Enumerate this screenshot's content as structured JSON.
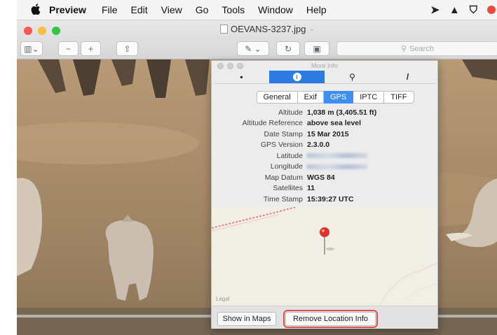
{
  "menubar": {
    "apple_glyph": "",
    "items": [
      "Preview",
      "File",
      "Edit",
      "View",
      "Go",
      "Tools",
      "Window",
      "Help"
    ],
    "status_icons": [
      "swirl-icon",
      "triangle-icon",
      "shield-icon",
      "badge-icon"
    ]
  },
  "window": {
    "title": "OEVANS-3237.jpg",
    "title_chevron": "⌄",
    "toolbar": {
      "sidebar_glyph": "▥⌄",
      "zoom_out": "−",
      "zoom_in": "+",
      "share_glyph": "⇧",
      "markup_glyph": "✎ ⌄",
      "rotate_glyph": "↻",
      "briefcase_glyph": "▣",
      "search_placeholder": "Search"
    }
  },
  "inspector": {
    "title": "More Info",
    "tabs": [
      {
        "name": "general-info-tab",
        "glyph": "▪"
      },
      {
        "name": "info-tab",
        "glyph": "i"
      },
      {
        "name": "magnify-tab",
        "glyph": "⚲"
      },
      {
        "name": "annotate-tab",
        "glyph": "/"
      }
    ],
    "segments": [
      "General",
      "Exif",
      "GPS",
      "IPTC",
      "TIFF"
    ],
    "active_segment": "GPS",
    "rows": [
      {
        "label": "Altitude",
        "value": "1,038 m (3,405.51 ft)"
      },
      {
        "label": "Altitude Reference",
        "value": "above sea level"
      },
      {
        "label": "Date Stamp",
        "value": "15 Mar 2015"
      },
      {
        "label": "GPS Version",
        "value": "2.3.0.0"
      },
      {
        "label": "Latitude",
        "value": ""
      },
      {
        "label": "Longitude",
        "value": ""
      },
      {
        "label": "Map Datum",
        "value": "WGS 84"
      },
      {
        "label": "Satellites",
        "value": "11"
      },
      {
        "label": "Time Stamp",
        "value": "15:39:27 UTC"
      }
    ],
    "map_legal": "Legal",
    "show_in_maps": "Show in Maps",
    "remove_location": "Remove Location Info"
  },
  "colors": {
    "accent": "#3d8ff1",
    "highlight_outline": "#d9534f",
    "pin": "#e0302a"
  }
}
